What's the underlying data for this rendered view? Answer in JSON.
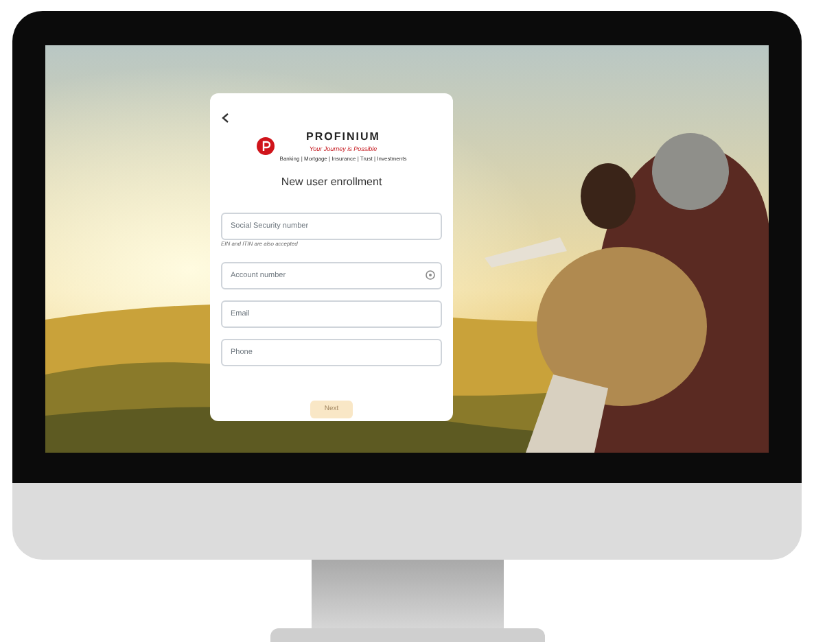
{
  "logo": {
    "name": "PROFINIUM",
    "tagline": "Your Journey is Possible",
    "services": "Banking | Mortgage | Insurance | Trust | Investments"
  },
  "title": "New user enrollment",
  "fields": [
    {
      "placeholder": "Social Security number",
      "hint": "EIN and ITIN are also accepted",
      "info": false
    },
    {
      "placeholder": "Account number",
      "info": true
    },
    {
      "placeholder": "Email",
      "info": false
    },
    {
      "placeholder": "Phone",
      "info": false
    }
  ],
  "next_button": {
    "label": "Next",
    "disabled": true
  }
}
